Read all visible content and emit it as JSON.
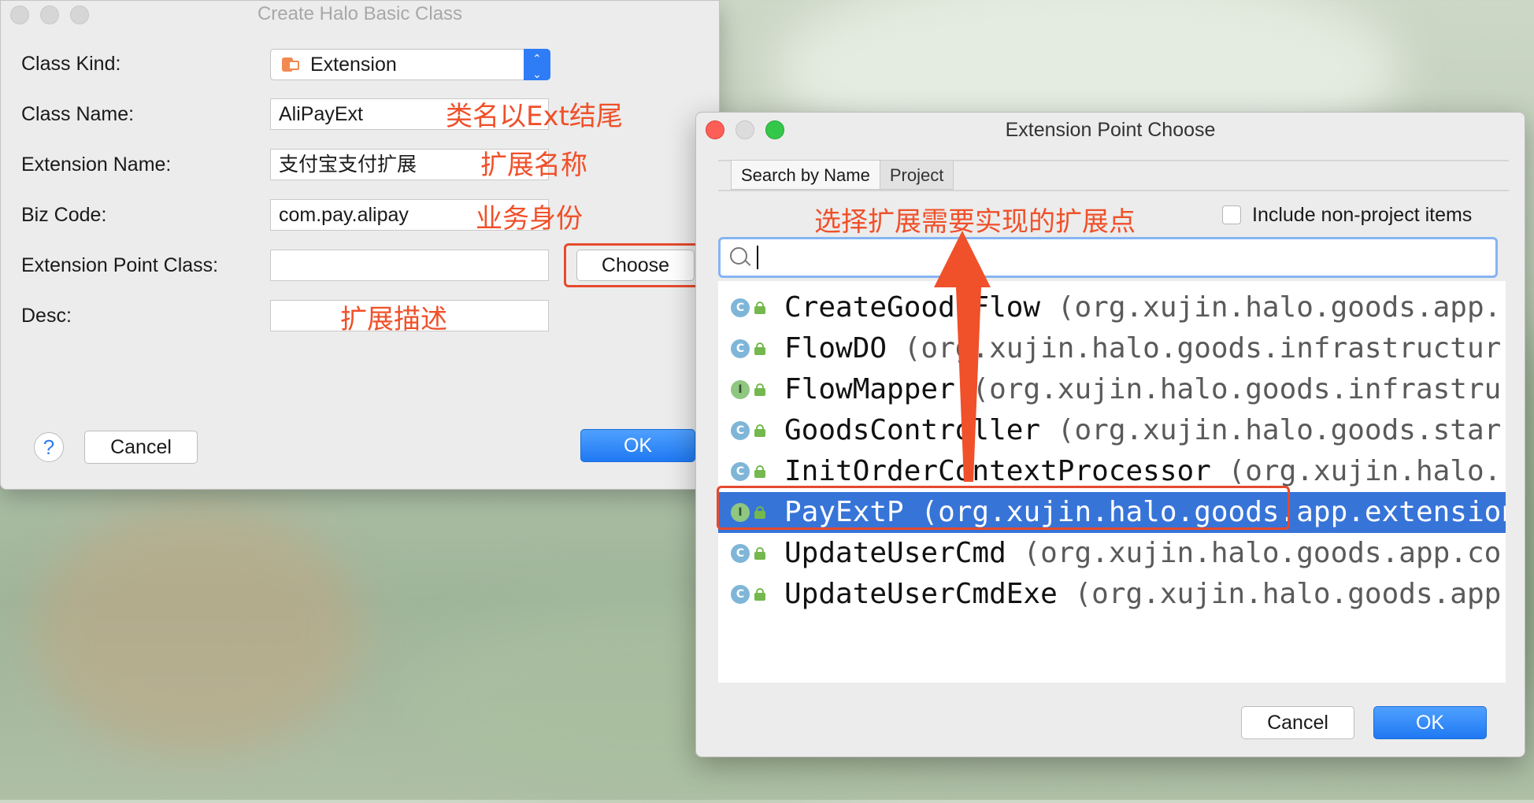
{
  "create_dialog": {
    "title": "Create Halo Basic Class",
    "labels": {
      "class_kind": "Class Kind:",
      "class_name": "Class  Name:",
      "extension_name": "Extension Name:",
      "biz_code": "Biz Code:",
      "extension_point_class": "Extension Point Class:",
      "desc": "Desc:"
    },
    "class_kind_value": "Extension",
    "class_kind_stepper": {
      "up": "⌃",
      "down": "⌄"
    },
    "class_name_value": "AliPayExt",
    "extension_name_value": "支付宝支付扩展",
    "biz_code_value": "com.pay.alipay",
    "extension_point_class_value": "",
    "desc_value": "",
    "choose_label": "Choose",
    "help_label": "?",
    "cancel_label": "Cancel",
    "ok_label": "OK"
  },
  "annotations": {
    "class_name_note": "类名以Ext结尾",
    "extension_name_note": "扩展名称",
    "biz_code_note": "业务身份",
    "desc_note": "扩展描述",
    "choose_point_note": "选择扩展需要实现的扩展点",
    "color": "#f0502a"
  },
  "chooser_dialog": {
    "title": "Extension Point Choose",
    "tabs": [
      "Search by Name",
      "Project"
    ],
    "include_non_project_label": "Include non-project items",
    "include_non_project_checked": false,
    "search_value": "",
    "items": [
      {
        "kind": "C",
        "name": "CreateGoodsFlow",
        "pkg": "(org.xujin.halo.goods.app.",
        "selected": false
      },
      {
        "kind": "C",
        "name": "FlowDO",
        "pkg": "(org.xujin.halo.goods.infrastructur",
        "selected": false
      },
      {
        "kind": "I",
        "name": "FlowMapper",
        "pkg": "(org.xujin.halo.goods.infrastru",
        "selected": false
      },
      {
        "kind": "C",
        "name": "GoodsController",
        "pkg": "(org.xujin.halo.goods.star",
        "selected": false
      },
      {
        "kind": "C",
        "name": "InitOrderContextProcessor",
        "pkg": "(org.xujin.halo.",
        "selected": false
      },
      {
        "kind": "I",
        "name": "PayExtP",
        "pkg": "(org.xujin.halo.goods.app.extension)",
        "selected": true
      },
      {
        "kind": "C",
        "name": "UpdateUserCmd",
        "pkg": "(org.xujin.halo.goods.app.co",
        "selected": false
      },
      {
        "kind": "C",
        "name": "UpdateUserCmdExe",
        "pkg": "(org.xujin.halo.goods.app",
        "selected": false
      }
    ],
    "cancel_label": "Cancel",
    "ok_label": "OK",
    "colors": {
      "selection": "#3774d8",
      "primary": "#1f79f2"
    }
  }
}
